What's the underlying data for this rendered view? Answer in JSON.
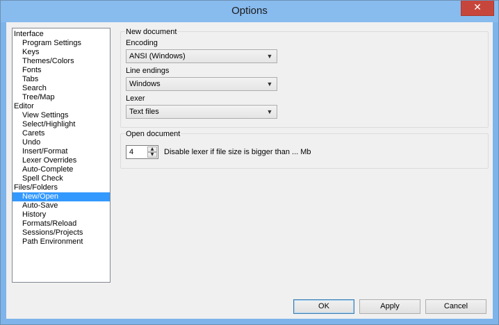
{
  "window": {
    "title": "Options",
    "close_glyph": "✕"
  },
  "tree": {
    "items": [
      {
        "label": "Interface",
        "level": 0
      },
      {
        "label": "Program Settings",
        "level": 1
      },
      {
        "label": "Keys",
        "level": 1
      },
      {
        "label": "Themes/Colors",
        "level": 1
      },
      {
        "label": "Fonts",
        "level": 1
      },
      {
        "label": "Tabs",
        "level": 1
      },
      {
        "label": "Search",
        "level": 1
      },
      {
        "label": "Tree/Map",
        "level": 1
      },
      {
        "label": "Editor",
        "level": 0
      },
      {
        "label": "View Settings",
        "level": 1
      },
      {
        "label": "Select/Highlight",
        "level": 1
      },
      {
        "label": "Carets",
        "level": 1
      },
      {
        "label": "Undo",
        "level": 1
      },
      {
        "label": "Insert/Format",
        "level": 1
      },
      {
        "label": "Lexer Overrides",
        "level": 1
      },
      {
        "label": "Auto-Complete",
        "level": 1
      },
      {
        "label": "Spell Check",
        "level": 1
      },
      {
        "label": "Files/Folders",
        "level": 0
      },
      {
        "label": "New/Open",
        "level": 1,
        "selected": true
      },
      {
        "label": "Auto-Save",
        "level": 1
      },
      {
        "label": "History",
        "level": 1
      },
      {
        "label": "Formats/Reload",
        "level": 1
      },
      {
        "label": "Sessions/Projects",
        "level": 1
      },
      {
        "label": "Path Environment",
        "level": 1
      }
    ]
  },
  "new_document": {
    "title": "New document",
    "encoding_label": "Encoding",
    "encoding_value": "ANSI (Windows)",
    "line_endings_label": "Line endings",
    "line_endings_value": "Windows",
    "lexer_label": "Lexer",
    "lexer_value": "Text files"
  },
  "open_document": {
    "title": "Open document",
    "size_value": "4",
    "size_label": "Disable lexer if file size is bigger than ... Mb"
  },
  "buttons": {
    "ok": "OK",
    "apply": "Apply",
    "cancel": "Cancel"
  },
  "colors": {
    "selection": "#3399ff",
    "titlebar": "#88bbee",
    "close": "#c7463b"
  }
}
